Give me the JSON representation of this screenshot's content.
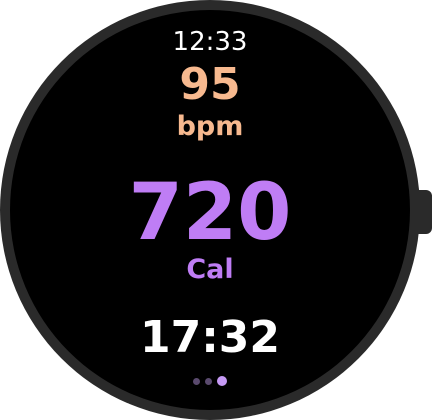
{
  "watch": {
    "time": "12:33"
  },
  "heart_rate": {
    "value": "95",
    "unit": "bpm",
    "color": "#f7b98f"
  },
  "calories": {
    "value": "720",
    "unit": "Cal",
    "color": "#bf7df5"
  },
  "workout": {
    "duration": "17:32"
  },
  "pager": {
    "count": 3,
    "active_index": 2,
    "inactive_color": "#5a4a6e",
    "active_color": "#c69af5"
  }
}
